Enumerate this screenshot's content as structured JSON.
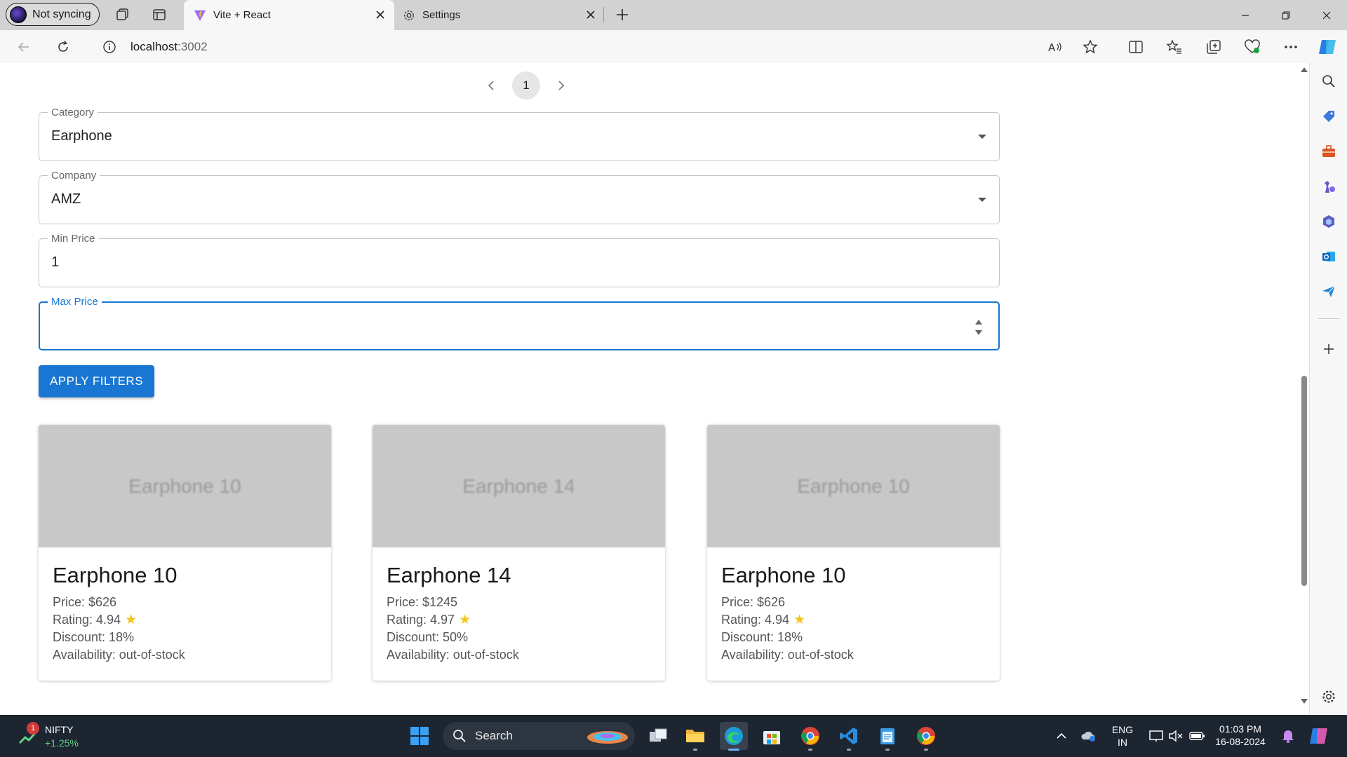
{
  "browser": {
    "profile_label": "Not syncing",
    "tabs": [
      {
        "title": "Vite + React",
        "active": true,
        "icon": "vite-icon"
      },
      {
        "title": "Settings",
        "active": false,
        "icon": "gear-icon"
      }
    ],
    "address": {
      "host": "localhost",
      "port": ":3002"
    }
  },
  "page": {
    "pagination": {
      "current_page": "1"
    },
    "filters": {
      "category": {
        "label": "Category",
        "value": "Earphone"
      },
      "company": {
        "label": "Company",
        "value": "AMZ"
      },
      "min_price": {
        "label": "Min Price",
        "value": "1"
      },
      "max_price": {
        "label": "Max Price",
        "value": ""
      }
    },
    "apply_button": "APPLY FILTERS",
    "products": [
      {
        "image_text": "Earphone 10",
        "name": "Earphone 10",
        "price": "Price: $626",
        "rating": "Rating: 4.94",
        "discount": "Discount: 18%",
        "availability": "Availability: out-of-stock"
      },
      {
        "image_text": "Earphone 14",
        "name": "Earphone 14",
        "price": "Price: $1245",
        "rating": "Rating: 4.97",
        "discount": "Discount: 50%",
        "availability": "Availability: out-of-stock"
      },
      {
        "image_text": "Earphone 10",
        "name": "Earphone 10",
        "price": "Price: $626",
        "rating": "Rating: 4.94",
        "discount": "Discount: 18%",
        "availability": "Availability: out-of-stock"
      }
    ]
  },
  "taskbar": {
    "ticker": {
      "badge": "1",
      "name": "NIFTY",
      "change": "+1.25%"
    },
    "search_label": "Search",
    "language": {
      "line1": "ENG",
      "line2": "IN"
    },
    "clock": {
      "time": "01:03 PM",
      "date": "16-08-2024"
    }
  },
  "colors": {
    "accent": "#1976d2",
    "star": "#f5c518",
    "taskbar": "#1d2530"
  }
}
